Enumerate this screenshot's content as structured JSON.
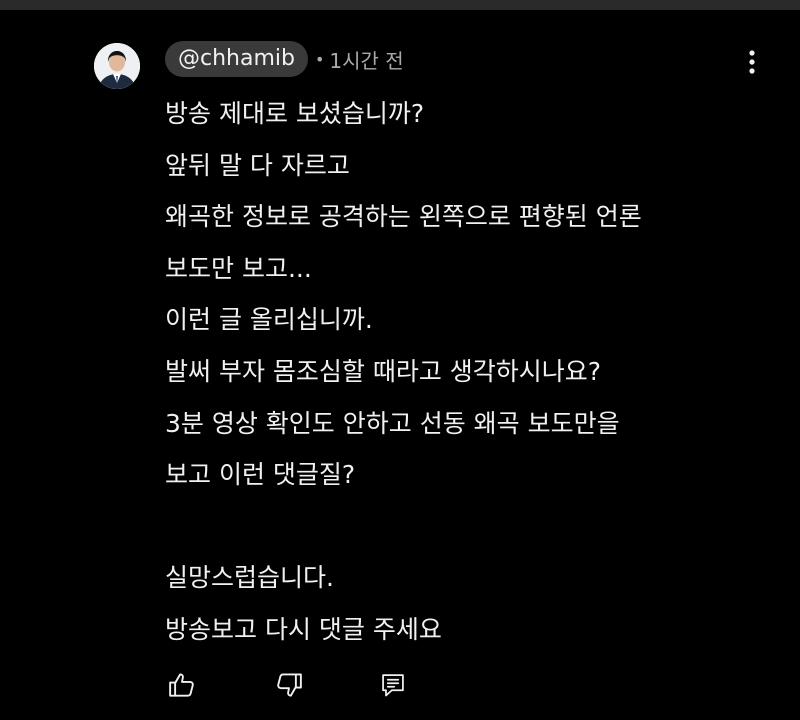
{
  "comment": {
    "author_handle": "@chhamib",
    "separator": "•",
    "timestamp": "1시간 전",
    "body_lines": [
      "방송 제대로 보셨습니까?",
      "앞뒤 말 다 자르고",
      "왜곡한 정보로 공격하는 왼쪽으로 편향된 언론",
      "보도만 보고...",
      "이런 글 올리십니까.",
      "발써 부자 몸조심할 때라고 생각하시나요?",
      "3분 영상 확인도 안하고 선동 왜곡 보도만을",
      "보고 이런 댓글질?",
      "",
      "실망스럽습니다.",
      "방송보고 다시 댓글 주세요"
    ],
    "icons": {
      "more": "more-vert-icon",
      "like": "thumb-up-icon",
      "dislike": "thumb-down-icon",
      "reply": "reply-comment-icon"
    }
  },
  "colors": {
    "background": "#000000",
    "text": "#f1f1f1",
    "secondary_text": "#aaaaaa",
    "handle_chip": "#3a3a3a"
  }
}
